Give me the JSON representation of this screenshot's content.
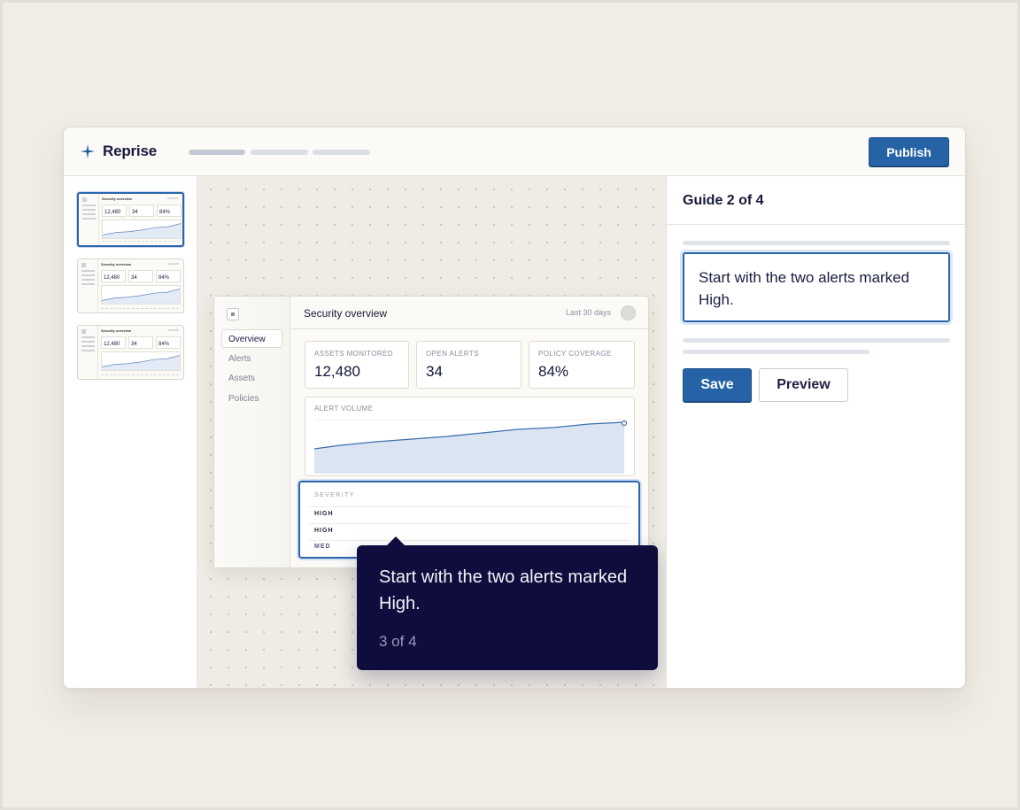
{
  "app": {
    "name": "Reprise",
    "publish_label": "Publish",
    "accent": "#2563a6"
  },
  "mock": {
    "title": "Security overview",
    "range": "Last 30 days",
    "nav": [
      "Overview",
      "Alerts",
      "Assets",
      "Policies"
    ],
    "kpis": [
      {
        "label": "ASSETS MONITORED",
        "value": "12,480"
      },
      {
        "label": "OPEN ALERTS",
        "value": "34"
      },
      {
        "label": "POLICY COVERAGE",
        "value": "84%"
      }
    ],
    "chart_label": "ALERT VOLUME",
    "severity_header": "SEVERITY",
    "severity_rows": [
      "HIGH",
      "HIGH",
      "MED"
    ]
  },
  "thumbs": {
    "title": "Security overview",
    "kpi_values": [
      "12,480",
      "34",
      "84%"
    ]
  },
  "tooltip": {
    "text": "Start with the two alerts marked High.",
    "step": "3 of 4"
  },
  "panel": {
    "title": "Guide 2 of 4",
    "editor_value": "Start with the two alerts marked High.",
    "save_label": "Save",
    "preview_label": "Preview"
  }
}
